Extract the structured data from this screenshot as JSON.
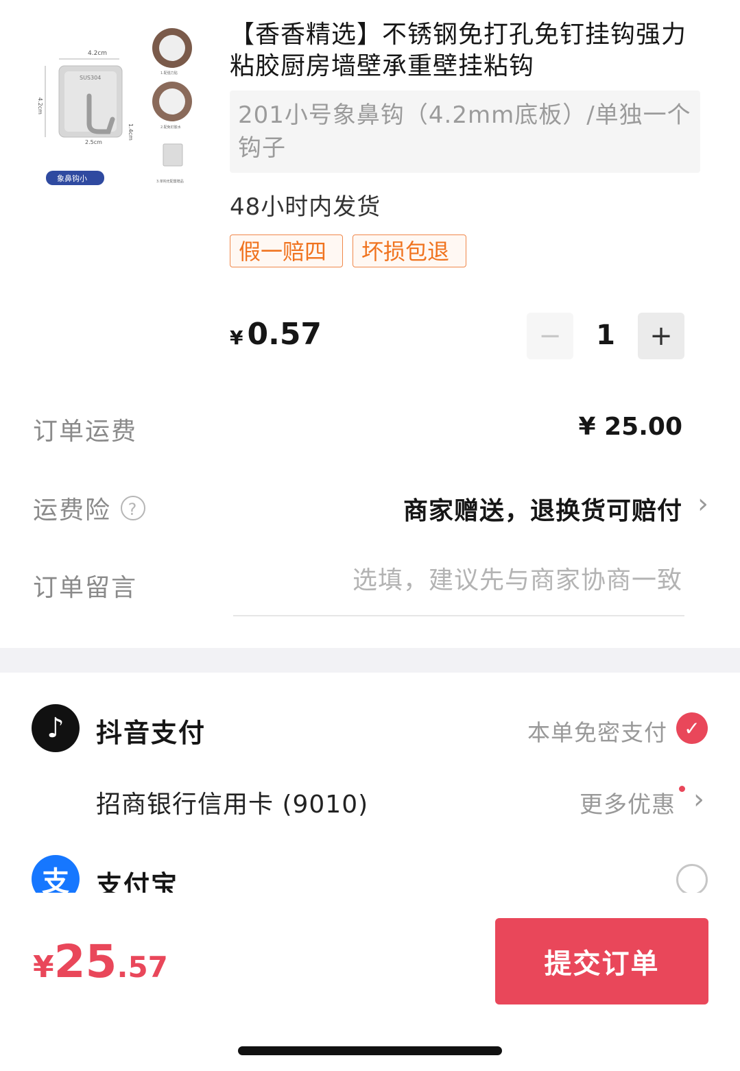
{
  "product": {
    "image_texts": [
      "4.2cm",
      "SUS304",
      "4.2cm",
      "1.4cm",
      "2.5cm",
      "象鼻钩小",
      "1.配强力贴",
      "2.配免钉胶水",
      "3.单钩无配置赠品"
    ],
    "title": "【香香精选】不锈钢免打孔免钉挂钩强力粘胶厨房墙壁承重壁挂粘钩",
    "sku": "201小号象鼻钩（4.2mm底板）/单独一个钩子",
    "shipping": "48小时内发货",
    "tags": [
      "假一赔四",
      "坏损包退"
    ],
    "price_symbol": "¥",
    "price": "0.57",
    "quantity": "1",
    "minus": "−",
    "plus": "+"
  },
  "order": {
    "freight_label": "订单运费",
    "freight_value": "¥ 25.00",
    "insurance_label": "运费险",
    "insurance_help": "?",
    "insurance_value": "商家赠送，退换货可赔付",
    "message_label": "订单留言",
    "message_placeholder": "选填，建议先与商家协商一致",
    "message_value": ""
  },
  "payment": {
    "douyin": {
      "name": "抖音支付",
      "icon": "douyin-icon",
      "glyph": "♪",
      "note": "本单免密支付",
      "selected": true
    },
    "card": {
      "name": "招商银行信用卡 (9010)",
      "more": "更多优惠"
    },
    "alipay": {
      "name": "支付宝",
      "icon": "alipay-icon",
      "glyph": "支",
      "selected": false
    }
  },
  "footer": {
    "total_symbol": "¥",
    "total_int": "25",
    "total_dec": ".57",
    "submit_label": "提交订单"
  },
  "colors": {
    "accent": "#e9475a",
    "tag": "#f0731f",
    "alipay": "#1677ff"
  }
}
